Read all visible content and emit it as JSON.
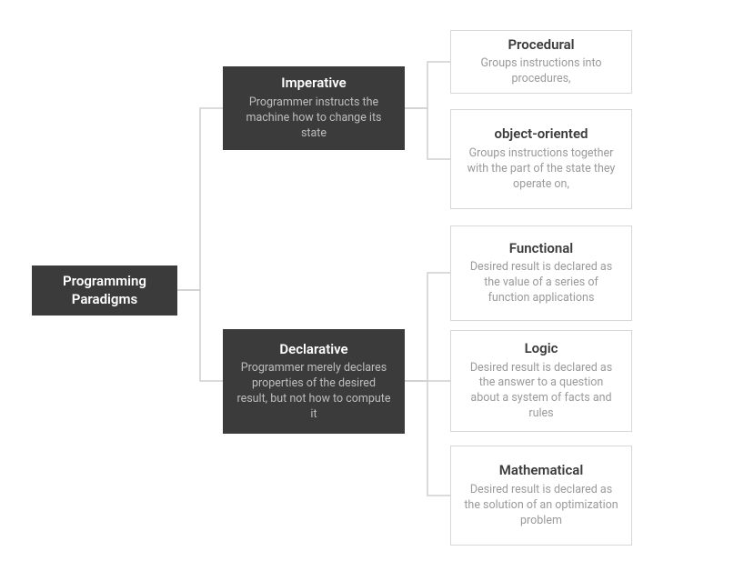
{
  "root": {
    "title": "Programming Paradigms"
  },
  "level1": {
    "imperative": {
      "title": "Imperative",
      "subtitle": "Programmer instructs the machine how to change its state"
    },
    "declarative": {
      "title": "Declarative",
      "subtitle": "Programmer merely declares properties of the desired result, but not how to compute it"
    }
  },
  "level2": {
    "procedural": {
      "title": "Procedural",
      "subtitle": "Groups instructions into procedures,"
    },
    "object_oriented": {
      "title": "object-oriented",
      "subtitle": "Groups instructions together with the part of the state they operate on,"
    },
    "functional": {
      "title": "Functional",
      "subtitle": "Desired result is declared as the value of a series of function applications"
    },
    "logic": {
      "title": "Logic",
      "subtitle": "Desired result is declared as the answer to a question about a system of facts and rules"
    },
    "mathematical": {
      "title": "Mathematical",
      "subtitle": "Desired result is declared as the solution of an optimization problem"
    }
  }
}
